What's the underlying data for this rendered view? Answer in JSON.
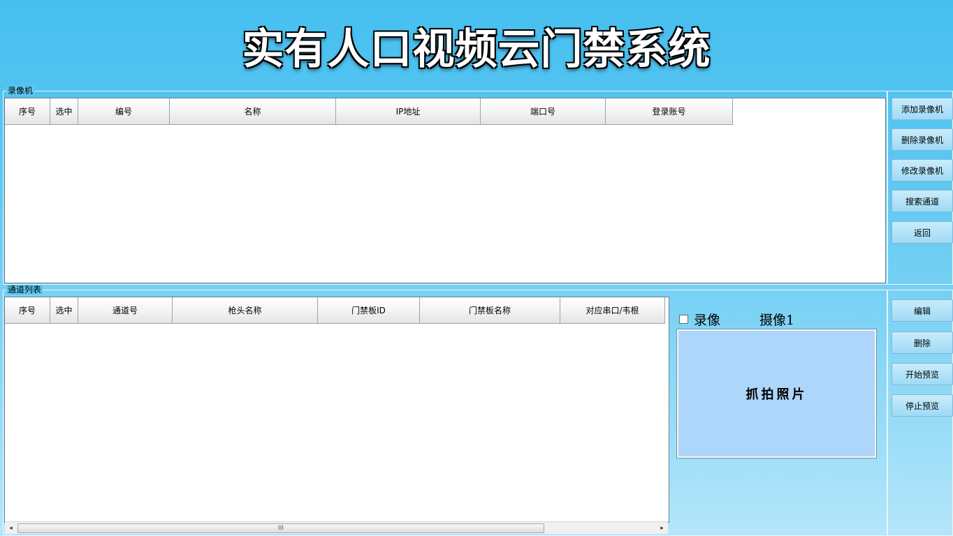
{
  "title": "实有人口视频云门禁系统",
  "recorder_group": {
    "label": "录像机",
    "columns": [
      "序号",
      "选中",
      "编号",
      "名称",
      "IP地址",
      "端口号",
      "登录账号"
    ]
  },
  "channel_group": {
    "label": "通道列表",
    "columns": [
      "序号",
      "选中",
      "通道号",
      "枪头名称",
      "门禁板ID",
      "门禁板名称",
      "对应串口/韦根"
    ]
  },
  "recorder_buttons": [
    "添加录像机",
    "删除录像机",
    "修改录像机",
    "搜索通道",
    "返回"
  ],
  "channel_buttons": [
    "编辑",
    "删除",
    "开始预览",
    "停止预览"
  ],
  "preview": {
    "record_label": "录像",
    "record_checked": false,
    "camera_label": "摄像1",
    "snapshot_label": "抓拍照片"
  },
  "scrollbar": {
    "left_arrow": "◂",
    "right_arrow": "▸",
    "thumb_grip": "III"
  }
}
